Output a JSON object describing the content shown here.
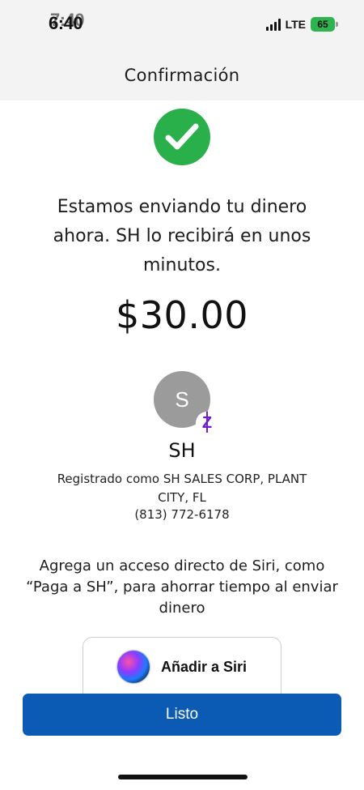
{
  "status_bar": {
    "time": "6:40",
    "time_overlay": "7:40",
    "network": "LTE",
    "battery": "65",
    "colors": {
      "battery": "#2fb34f"
    }
  },
  "header": {
    "title": "Confirmación"
  },
  "confirmation": {
    "icon": "checkmark-circle-icon",
    "message": "Estamos enviando tu dinero ahora. SH lo recibirá en unos minutos.",
    "amount": "$30.00",
    "colors": {
      "success": "#29b04a"
    }
  },
  "recipient": {
    "initial": "S",
    "name": "SH",
    "registered": "Registrado como SH SALES CORP, PLANT CITY, FL",
    "phone": "(813) 772-6178",
    "badge_icon": "zelle-logo-icon",
    "colors": {
      "avatar": "#9b9b9b",
      "zelle": "#6d1ed4"
    }
  },
  "siri": {
    "prompt": "Agrega un acceso directo de Siri, como “Paga a SH”, para ahorrar tiempo al enviar dinero",
    "button_label": "Añadir a Siri",
    "icon": "siri-icon"
  },
  "footer": {
    "done_label": "Listo",
    "colors": {
      "primary": "#0b5bb5"
    }
  }
}
